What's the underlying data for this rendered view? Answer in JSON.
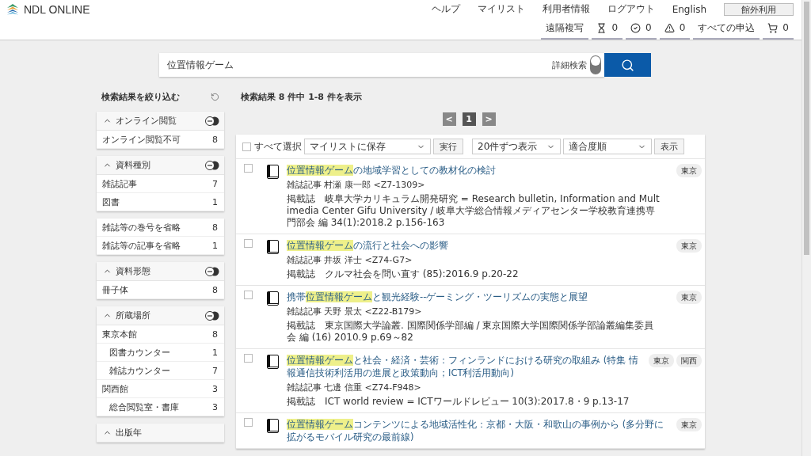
{
  "header": {
    "logo": "NDL ONLINE",
    "nav": [
      "ヘルプ",
      "マイリスト",
      "利用者情報",
      "ログアウト",
      "English"
    ],
    "mode_button": "館外利用",
    "status": [
      {
        "kind": "text",
        "label": "遠隔複写"
      },
      {
        "kind": "hourglass",
        "label": "0"
      },
      {
        "kind": "check",
        "label": "0"
      },
      {
        "kind": "warning",
        "label": "0"
      },
      {
        "kind": "text",
        "label": "すべての申込"
      },
      {
        "kind": "cart",
        "label": "0"
      }
    ]
  },
  "search": {
    "value": "位置情報ゲーム",
    "advanced_label": "詳細検索",
    "advanced_on": false
  },
  "sidebar": {
    "title": "検索結果を絞り込む",
    "groups": [
      {
        "title": "オンライン閲覧",
        "expanded": true,
        "items": [
          {
            "label": "オンライン閲覧不可",
            "count": "8"
          }
        ]
      },
      {
        "title": "資料種別",
        "expanded": true,
        "items": [
          {
            "label": "雑誌記事",
            "count": "7"
          },
          {
            "label": "図書",
            "count": "1"
          }
        ]
      },
      {
        "items": [
          {
            "label": "雑誌等の巻号を省略",
            "count": "8"
          },
          {
            "label": "雑誌等の記事を省略",
            "count": "1"
          }
        ]
      },
      {
        "title": "資料形態",
        "expanded": true,
        "items": [
          {
            "label": "冊子体",
            "count": "8"
          }
        ]
      },
      {
        "title": "所蔵場所",
        "expanded": true,
        "items": [
          {
            "label": "東京本館",
            "count": "8",
            "children": [
              {
                "label": "図書カウンター",
                "count": "1"
              },
              {
                "label": "雑誌カウンター",
                "count": "7"
              }
            ]
          },
          {
            "label": "関西館",
            "count": "3",
            "children": [
              {
                "label": "総合閲覧室・書庫",
                "count": "3"
              }
            ]
          }
        ]
      },
      {
        "title": "出版年",
        "expanded": true
      }
    ]
  },
  "results": {
    "summary": "検索結果 8 件中 1-8 件を表示",
    "pager": [
      {
        "label": "<",
        "kind": "prev",
        "selected": false
      },
      {
        "label": "1",
        "kind": "page",
        "selected": true
      },
      {
        "label": ">",
        "kind": "next",
        "selected": false
      }
    ],
    "toolbar": {
      "select_all": "すべて選択",
      "select_all_checked": false,
      "action": "マイリストに保存",
      "run": "実行",
      "per_page": "20件ずつ表示",
      "sort": "適合度順",
      "show": "表示"
    },
    "items": [
      {
        "checked": false,
        "title_parts": [
          {
            "text": "位置情報ゲーム",
            "highlighted": true
          },
          {
            "text": "の地域学習としての教材化の検討",
            "highlighted": false
          }
        ],
        "meta": "雑誌記事 村瀬 康一郎 <Z7-1309>",
        "source": "掲載誌　岐阜大学カリキュラム開発研究 = Research bulletin, Information and Multimedia Center Gifu University / 岐阜大学総合情報メディアセンター学校教育連携専門部会 編 34(1):2018.2 p.156-163",
        "tags": [
          "東京"
        ]
      },
      {
        "checked": false,
        "title_parts": [
          {
            "text": "位置情報ゲーム",
            "highlighted": true
          },
          {
            "text": "の流行と社会への影響",
            "highlighted": false
          }
        ],
        "meta": "雑誌記事 井坂 洋士 <Z74-G7>",
        "source": "掲載誌　クルマ社会を問い直す (85):2016.9 p.20-22",
        "tags": [
          "東京"
        ]
      },
      {
        "checked": false,
        "title_parts": [
          {
            "text": "携帯",
            "highlighted": false
          },
          {
            "text": "位置情報ゲーム",
            "highlighted": true
          },
          {
            "text": "と観光経験--ゲーミング・ツーリズムの実態と展望",
            "highlighted": false
          }
        ],
        "meta": "雑誌記事 天野 景太 <Z22-B179>",
        "source": "掲載誌　東京国際大学論叢. 国際関係学部編 / 東京国際大学国際関係学部論叢編集委員会 編 (16) 2010.9 p.69～82",
        "tags": [
          "東京"
        ]
      },
      {
        "checked": false,
        "title_parts": [
          {
            "text": "位置情報ゲーム",
            "highlighted": true
          },
          {
            "text": "と社会・経済・芸術：フィンランドにおける研究の取組み (特集 情報通信技術利活用の進展と政策動向；ICT利活用動向)",
            "highlighted": false
          }
        ],
        "meta": "雑誌記事 七邊 信重 <Z74-F948>",
        "source": "掲載誌　ICT world review = ICTワールドレビュー 10(3):2017.8・9 p.13-17",
        "tags": [
          "東京",
          "関西"
        ]
      },
      {
        "checked": false,
        "title_parts": [
          {
            "text": "位置情報ゲーム",
            "highlighted": true
          },
          {
            "text": "コンテンツによる地域活性化：京都・大阪・和歌山の事例から (多分野に拡がるモバイル研究の最前線)",
            "highlighted": false
          }
        ],
        "tags": [
          "東京"
        ]
      }
    ]
  }
}
